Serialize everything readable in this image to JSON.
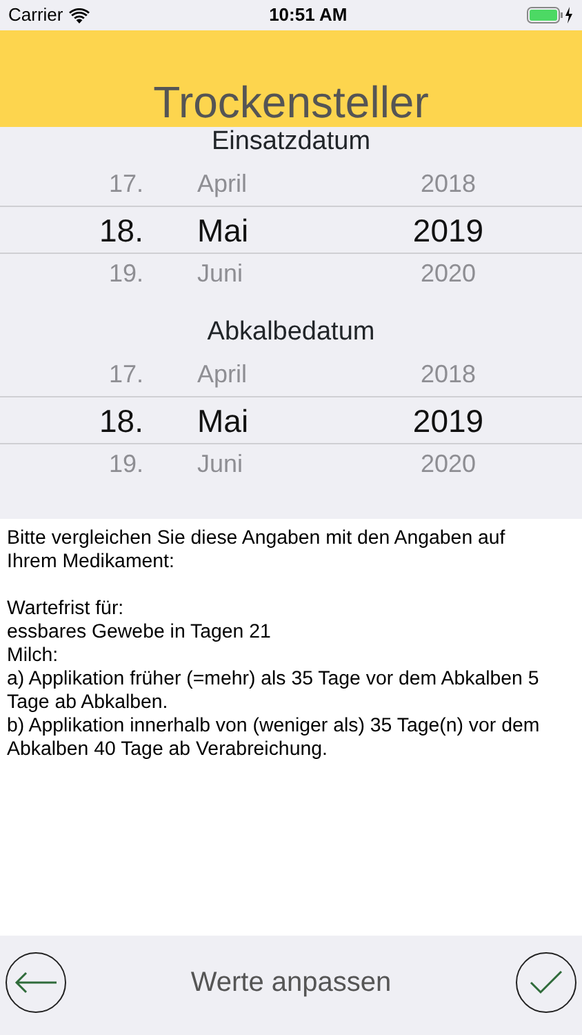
{
  "status_bar": {
    "carrier": "Carrier",
    "time": "10:51 AM"
  },
  "header": {
    "title": "Trockensteller"
  },
  "pickers": [
    {
      "label": "Einsatzdatum",
      "rows": [
        {
          "day": "17.",
          "month": "April",
          "year": "2018",
          "selected": false
        },
        {
          "day": "18.",
          "month": "Mai",
          "year": "2019",
          "selected": true
        },
        {
          "day": "19.",
          "month": "Juni",
          "year": "2020",
          "selected": false
        }
      ]
    },
    {
      "label": "Abkalbedatum",
      "rows": [
        {
          "day": "17.",
          "month": "April",
          "year": "2018",
          "selected": false
        },
        {
          "day": "18.",
          "month": "Mai",
          "year": "2019",
          "selected": true
        },
        {
          "day": "19.",
          "month": "Juni",
          "year": "2020",
          "selected": false
        }
      ]
    }
  ],
  "info": {
    "paragraphs": [
      "Bitte vergleichen Sie diese Angaben mit den Angaben auf Ihrem Medikament:",
      "Wartefrist für:",
      "essbares Gewebe in Tagen 21",
      "Milch:",
      "a) Applikation früher (=mehr) als 35 Tage vor dem Abkalben 5 Tage ab Abkalben.",
      "b) Applikation innerhalb von (weniger als) 35 Tage(n) vor dem Abkalben 40 Tage ab Verabreichung."
    ]
  },
  "bottom_bar": {
    "title": "Werte anpassen"
  }
}
